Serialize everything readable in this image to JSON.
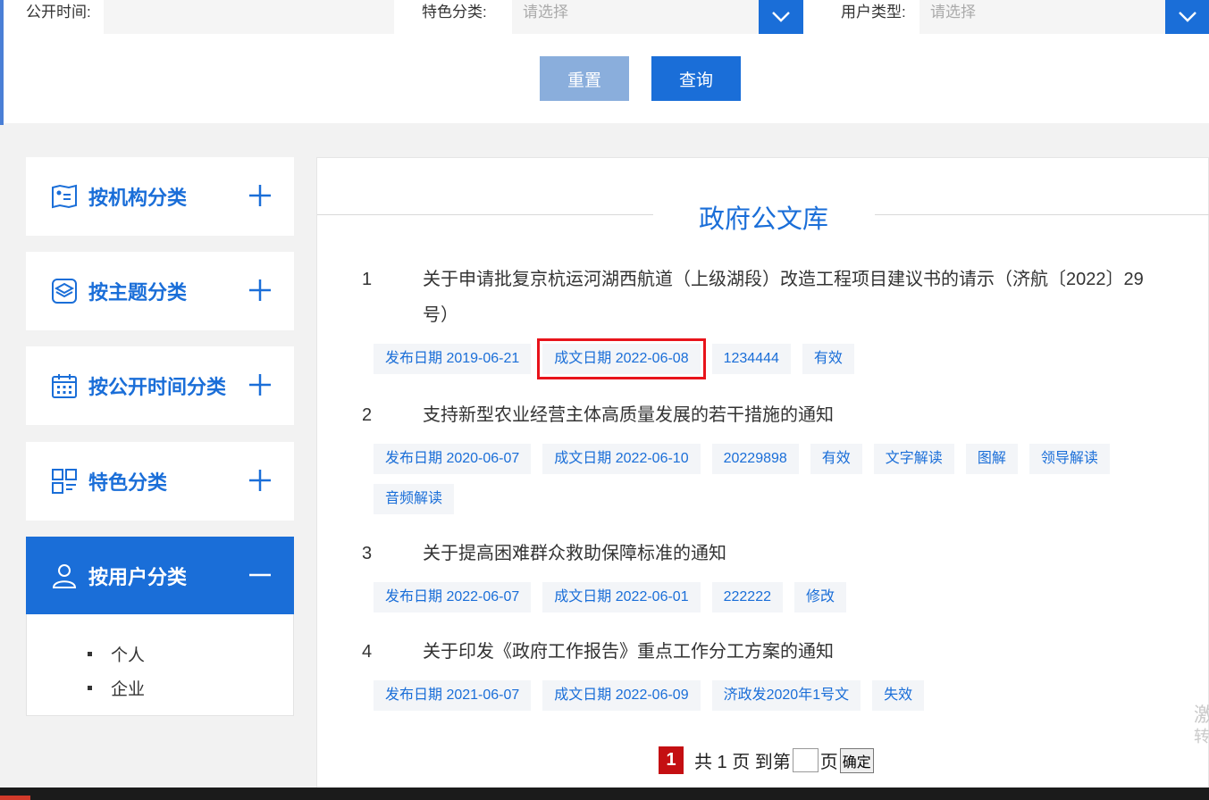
{
  "filters": {
    "public_time_label": "公开时间:",
    "feature_label": "特色分类:",
    "feature_placeholder": "请选择",
    "user_type_label": "用户类型:",
    "user_type_placeholder": "请选择"
  },
  "buttons": {
    "reset": "重置",
    "query": "查询"
  },
  "sidebar": {
    "items": [
      {
        "label": "按机构分类",
        "icon": "institution-icon",
        "expanded": false
      },
      {
        "label": "按主题分类",
        "icon": "layers-icon",
        "expanded": false
      },
      {
        "label": "按公开时间分类",
        "icon": "calendar-icon",
        "expanded": false
      },
      {
        "label": "特色分类",
        "icon": "grid-icon",
        "expanded": false
      },
      {
        "label": "按用户分类",
        "icon": "user-icon",
        "expanded": true
      }
    ],
    "sub_items": [
      "个人",
      "企业"
    ]
  },
  "main": {
    "title": "政府公文库",
    "documents": [
      {
        "num": "1",
        "title": "关于申请批复京杭运河湖西航道（上级湖段）改造工程项目建议书的请示（济航〔2022〕29号）",
        "tags": [
          "发布日期 2019-06-21",
          "成文日期 2022-06-08",
          "1234444",
          "有效"
        ]
      },
      {
        "num": "2",
        "title": "支持新型农业经营主体高质量发展的若干措施的通知",
        "tags": [
          "发布日期 2020-06-07",
          "成文日期 2022-06-10",
          "20229898",
          "有效",
          "文字解读",
          "图解",
          "领导解读",
          "音频解读"
        ]
      },
      {
        "num": "3",
        "title": "关于提高困难群众救助保障标准的通知",
        "tags": [
          "发布日期 2022-06-07",
          "成文日期 2022-06-01",
          "222222",
          "修改"
        ]
      },
      {
        "num": "4",
        "title": "关于印发《政府工作报告》重点工作分工方案的通知",
        "tags": [
          "发布日期 2021-06-07",
          "成文日期 2022-06-09",
          "济政发2020年1号文",
          "失效"
        ]
      }
    ]
  },
  "pager": {
    "current": "1",
    "text_total": "共 1 页 到第",
    "text_page": "页",
    "confirm": "确定"
  },
  "edge_text": [
    "激",
    "转"
  ],
  "colors": {
    "accent": "#1a6ed8",
    "highlight": "#e8141b",
    "pager_current": "#c40f12"
  }
}
